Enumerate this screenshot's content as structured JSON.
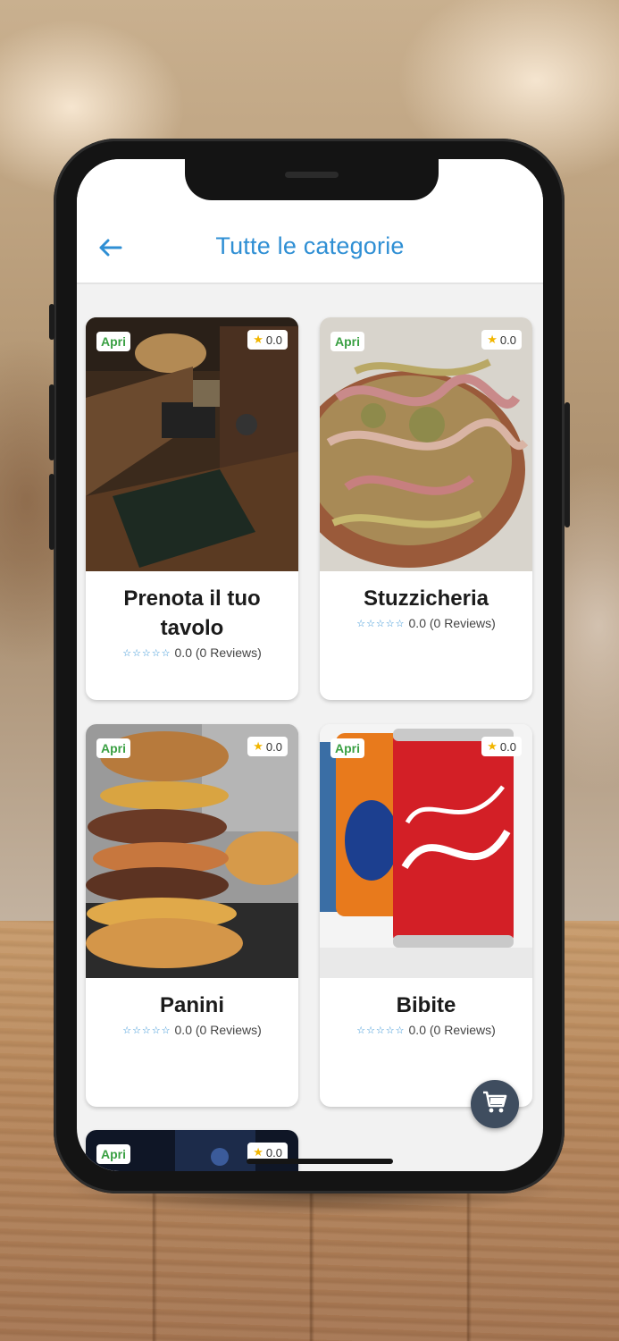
{
  "header": {
    "title": "Tutte le categorie"
  },
  "icons": {
    "back": "arrow-left-icon",
    "cart": "shopping-cart-icon",
    "star": "star-icon"
  },
  "colors": {
    "accent": "#2f8fd4",
    "open": "#3aa043",
    "fab": "#3f4d5f",
    "star": "#f2b600"
  },
  "categories": [
    {
      "name": "Prenota il tuo tavolo",
      "status": "Apri",
      "rating": "0.0",
      "reviews_text": "0.0 (0 Reviews)"
    },
    {
      "name": "Stuzzicheria",
      "status": "Apri",
      "rating": "0.0",
      "reviews_text": "0.0 (0 Reviews)"
    },
    {
      "name": "Panini",
      "status": "Apri",
      "rating": "0.0",
      "reviews_text": "0.0 (0 Reviews)"
    },
    {
      "name": "Bibite",
      "status": "Apri",
      "rating": "0.0",
      "reviews_text": "0.0 (0 Reviews)"
    },
    {
      "status": "Apri",
      "rating": "0.0"
    }
  ]
}
